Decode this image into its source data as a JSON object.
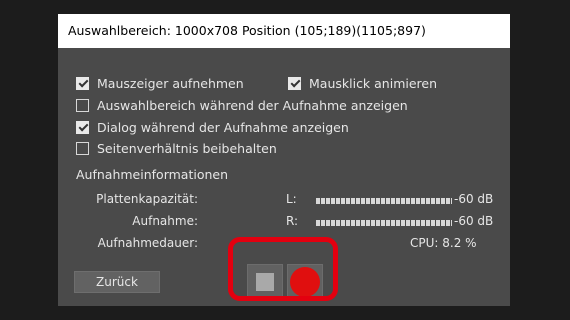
{
  "title": "Auswahlbereich: 1000x708 Position (105;189)(1105;897)",
  "options": {
    "mauszeiger": {
      "label": "Mauszeiger aufnehmen",
      "checked": true
    },
    "mausklick": {
      "label": "Mausklick animieren",
      "checked": true
    },
    "auswahlbereich": {
      "label": "Auswahlbereich während der Aufnahme anzeigen",
      "checked": false
    },
    "dialog": {
      "label": "Dialog während der Aufnahme anzeigen",
      "checked": true
    },
    "seitenverhaeltnis": {
      "label": "Seitenverhältnis beibehalten",
      "checked": false
    }
  },
  "info": {
    "section_title": "Aufnahmeinformationen",
    "plattenkapazitaet_label": "Plattenkapazität:",
    "channel_l": "L:",
    "level_l": "-60 dB",
    "aufnahme_label": "Aufnahme:",
    "channel_r": "R:",
    "level_r": "-60 dB",
    "aufnahmedauer_label": "Aufnahmedauer:",
    "cpu": "CPU: 8.2 %"
  },
  "buttons": {
    "back_label": "Zurück",
    "stop_icon": "stop-icon",
    "record_icon": "record-icon"
  },
  "colors": {
    "record": "#e00f0f",
    "highlight": "#e3000f",
    "panel": "#4a4a4a"
  }
}
